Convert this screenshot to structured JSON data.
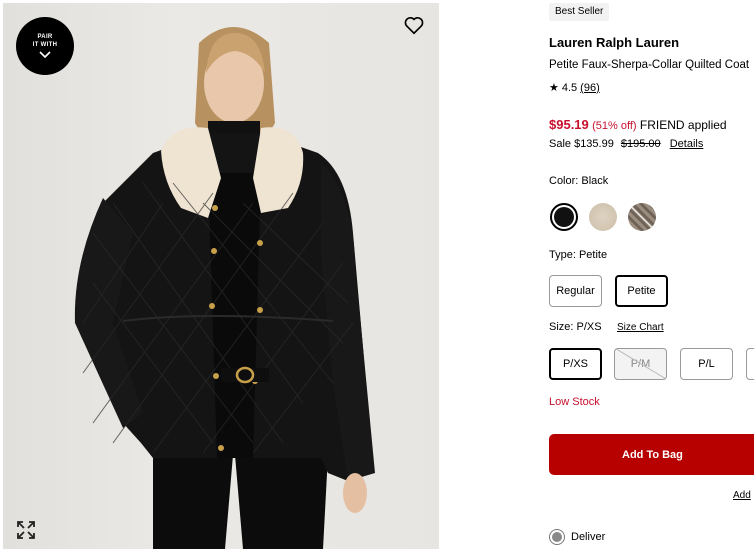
{
  "gallery": {
    "pair_badge_line1": "PAIR",
    "pair_badge_line2": "IT WITH",
    "image_alt": "Woman wearing black quilted coat with faux sherpa collar"
  },
  "product": {
    "badge": "Best Seller",
    "brand": "Lauren Ralph Lauren",
    "name": "Petite Faux-Sherpa-Collar Quilted Coat",
    "rating_star": "★",
    "rating_value": "4.5",
    "rating_count": "(96)"
  },
  "price": {
    "promo_price": "$95.19",
    "promo_pct": "(51% off)",
    "promo_note": "FRIEND applied",
    "sale_label": "Sale $135.99",
    "original": "$195.00",
    "details_link": "Details"
  },
  "color": {
    "label": "Color: Black",
    "swatches": [
      "Black",
      "Cream",
      "Plaid"
    ]
  },
  "type": {
    "label": "Type: Petite",
    "options": [
      "Regular",
      "Petite"
    ],
    "selected": "Petite"
  },
  "size": {
    "label": "Size: P/XS",
    "chart_link": "Size Chart",
    "options": [
      "P/XS",
      "P/M",
      "P/L",
      ""
    ],
    "selected": "P/XS"
  },
  "stock": {
    "status": "Low Stock"
  },
  "actions": {
    "add_to_bag": "Add To Bag",
    "add_link": "Add",
    "deliver_label": "Deliver"
  },
  "colors": {
    "accent": "#c8102e",
    "button": "#b70000"
  }
}
